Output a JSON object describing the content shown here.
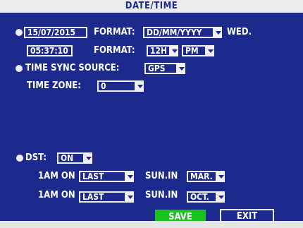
{
  "title": "DATE/TIME",
  "date_row": {
    "date_value": "15/07/2015",
    "format_label": "FORMAT:",
    "date_format": "DD/MM/YYYY",
    "weekday": "WED."
  },
  "time_row": {
    "time_value": "05:37:10",
    "format_label": "FORMAT:",
    "hour_format": "12H",
    "ampm": "PM"
  },
  "sync": {
    "label": "TIME SYNC SOURCE:",
    "source": "GPS"
  },
  "timezone": {
    "label": "TIME ZONE:",
    "value": "0"
  },
  "dst": {
    "label": "DST:",
    "value": "ON",
    "start": {
      "time_label": "1AM ON",
      "week": "LAST",
      "day_label": "SUN.IN",
      "month": "MAR."
    },
    "end": {
      "time_label": "1AM ON",
      "week": "LAST",
      "day_label": "SUN.IN",
      "month": "OCT."
    }
  },
  "buttons": {
    "save": "SAVE",
    "exit": "EXIT"
  },
  "colors": {
    "background": "#1c2a8e",
    "title_bar": "#ececec",
    "save_button": "#19c21c",
    "text": "#ffffff"
  },
  "icons": {
    "radio": "radio-dot-icon",
    "dropdown": "chevron-down-icon"
  }
}
